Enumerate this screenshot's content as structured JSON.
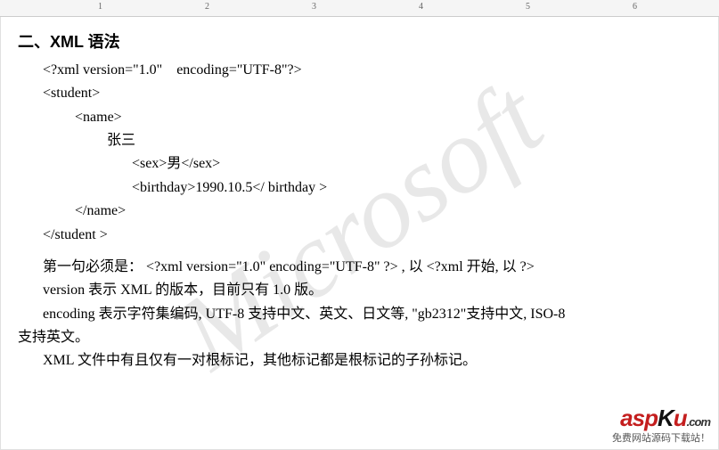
{
  "ruler": {
    "n1": "1",
    "n2": "2",
    "n3": "3",
    "n4": "4",
    "n5": "5",
    "n6": "6"
  },
  "heading": "二、XML 语法",
  "code": {
    "l1": "<?xml version=\"1.0\"    encoding=\"UTF-8\"?>",
    "l2": "<student>",
    "l3": "<name>",
    "l4": "张三",
    "l5": "<sex>男</sex>",
    "l6": "<birthday>1990.10.5</ birthday >",
    "l7": "</name>",
    "l8": "</student >"
  },
  "para1_line1": "第一句必须是：  <?xml version=\"1.0\"    encoding=\"UTF-8\" ?> , 以 <?xml 开始, 以 ?>",
  "para1_line2": "version 表示 XML 的版本，目前只有 1.0 版。",
  "para2_line1": "encoding 表示字符集编码, UTF-8 支持中文、英文、日文等, \"gb2312\"支持中文, ISO-8",
  "para2_line2": "支持英文。",
  "para3": "XML 文件中有且仅有一对根标记，其他标记都是根标记的子孙标记。",
  "watermark": "Microsoft",
  "logo": {
    "asp": "asp",
    "ku": "K",
    "u": "u",
    "com": ".com",
    "sub": "免费网站源码下载站！"
  }
}
